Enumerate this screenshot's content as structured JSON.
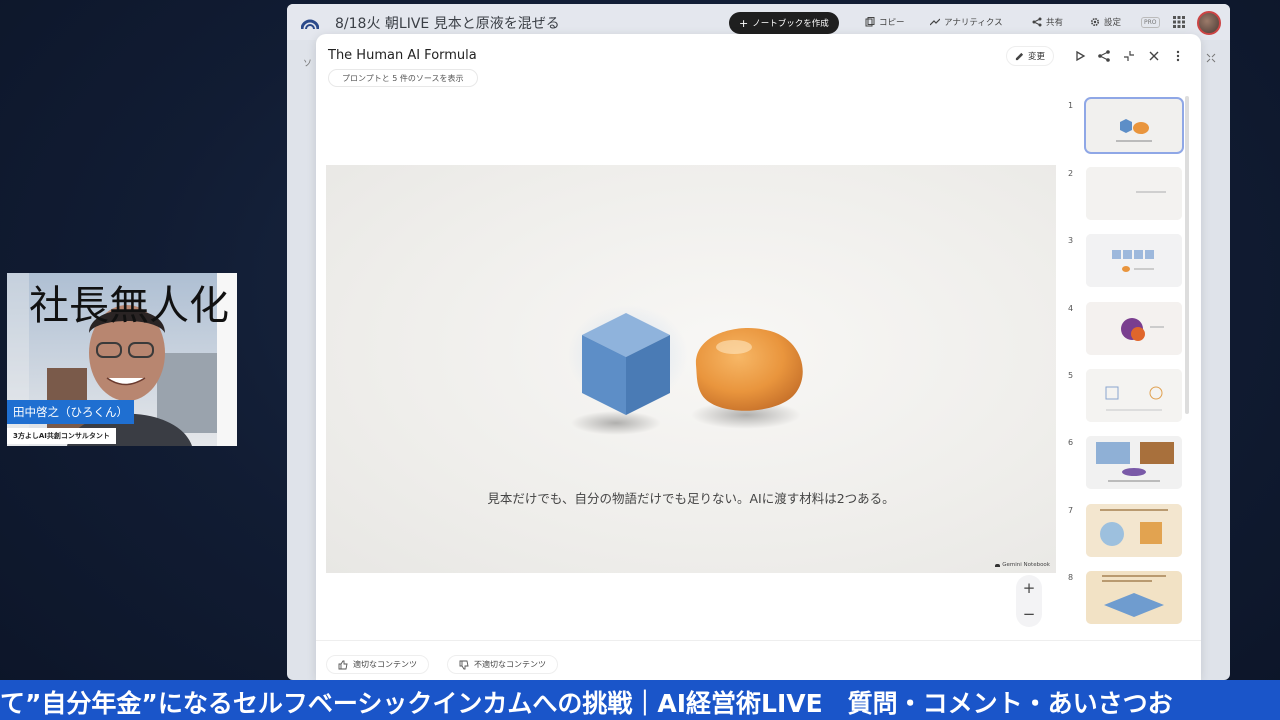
{
  "outer": {
    "notebook_title": "8/18火 朝LIVE 見本と原液を混ぜる",
    "create_notebook_label": "ノートブックを作成",
    "copy_label": "コピー",
    "analytics_label": "アナリティクス",
    "share_label": "共有",
    "settings_label": "設定",
    "pro_label": "PRO",
    "left_strip_char": "ソ"
  },
  "modal": {
    "title": "The Human AI Formula",
    "sources_chip": "プロンプトと 5 件のソースを表示",
    "edit_label": "変更",
    "slide": {
      "caption": "見本だけでも、自分の物語だけでも足りない。AIに渡す材料は2つある。",
      "watermark": "Gemini Notebook"
    },
    "zoom": {
      "plus": "+",
      "minus": "−"
    },
    "thumbnails": [
      {
        "num": "1"
      },
      {
        "num": "2"
      },
      {
        "num": "3"
      },
      {
        "num": "4"
      },
      {
        "num": "5"
      },
      {
        "num": "6"
      },
      {
        "num": "7"
      },
      {
        "num": "8"
      }
    ],
    "feedback": {
      "good_label": "適切なコンテンツ",
      "bad_label": "不適切なコンテンツ"
    }
  },
  "webcam": {
    "bg_text": "社長無人化",
    "name": "田中啓之（ひろくん）",
    "title": "3方よしAI共創コンサルタント"
  },
  "ticker": {
    "text": "て”自分年金”になるセルフベーシックインカムへの挑戦｜AI経営術LIVE　質問・コメント・あいさつお"
  }
}
